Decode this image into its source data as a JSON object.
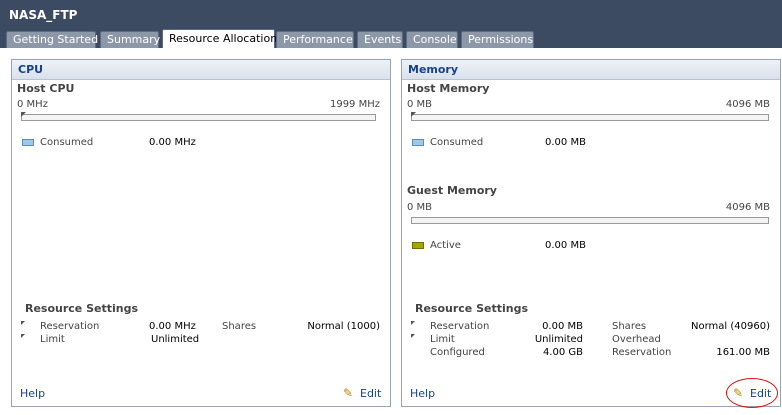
{
  "window": {
    "title": "NASA_FTP"
  },
  "tabs": [
    "Getting Started",
    "Summary",
    "Resource Allocation",
    "Performance",
    "Events",
    "Console",
    "Permissions"
  ],
  "active_tab": "Resource Allocation",
  "cpu": {
    "title": "CPU",
    "host_title": "Host CPU",
    "range_min": "0 MHz",
    "range_max": "1999 MHz",
    "consumed_label": "Consumed",
    "consumed_value": "0.00 MHz",
    "consumed_color": "#9fc7e8",
    "settings_title": "Resource Settings",
    "reservation_label": "Reservation",
    "reservation_value": "0.00 MHz",
    "limit_label": "Limit",
    "limit_value": "Unlimited",
    "shares_label": "Shares",
    "shares_value": "Normal (1000)",
    "help": "Help",
    "edit": "Edit"
  },
  "memory": {
    "title": "Memory",
    "host_title": "Host Memory",
    "host_min": "0 MB",
    "host_max": "4096 MB",
    "consumed_label": "Consumed",
    "consumed_value": "0.00 MB",
    "consumed_color": "#9fc7e8",
    "guest_title": "Guest Memory",
    "guest_min": "0 MB",
    "guest_max": "4096 MB",
    "active_label": "Active",
    "active_value": "0.00 MB",
    "active_color": "#a6a600",
    "settings_title": "Resource Settings",
    "reservation_label": "Reservation",
    "reservation_value": "0.00 MB",
    "limit_label": "Limit",
    "limit_value": "Unlimited",
    "configured_label": "Configured",
    "configured_value": "4.00 GB",
    "shares_label": "Shares",
    "shares_value": "Normal (40960)",
    "overhead_label": "Overhead",
    "overhead_reservation_label": "Reservation",
    "overhead_reservation_value": "161.00 MB",
    "help": "Help",
    "edit": "Edit"
  }
}
